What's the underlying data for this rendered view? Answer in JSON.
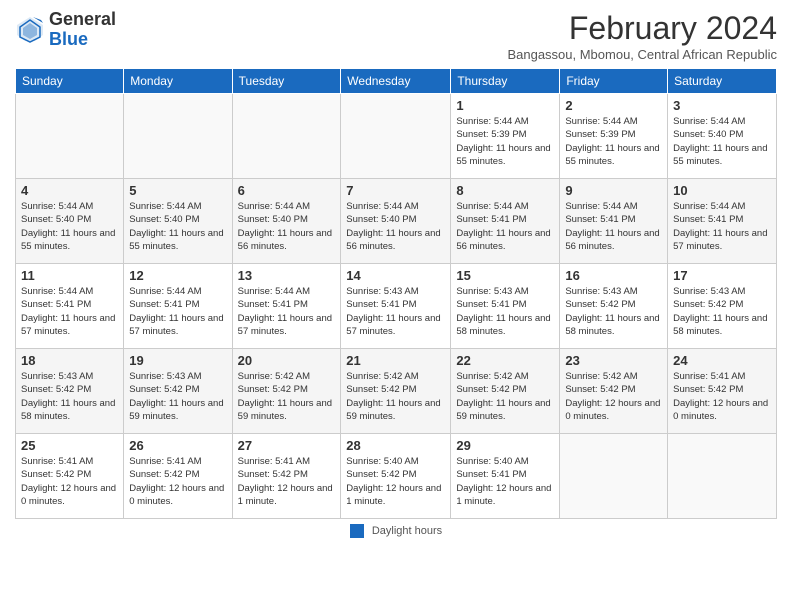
{
  "logo": {
    "general": "General",
    "blue": "Blue"
  },
  "title": "February 2024",
  "subtitle": "Bangassou, Mbomou, Central African Republic",
  "days_of_week": [
    "Sunday",
    "Monday",
    "Tuesday",
    "Wednesday",
    "Thursday",
    "Friday",
    "Saturday"
  ],
  "weeks": [
    [
      {
        "day": "",
        "info": ""
      },
      {
        "day": "",
        "info": ""
      },
      {
        "day": "",
        "info": ""
      },
      {
        "day": "",
        "info": ""
      },
      {
        "day": "1",
        "info": "Sunrise: 5:44 AM\nSunset: 5:39 PM\nDaylight: 11 hours and 55 minutes."
      },
      {
        "day": "2",
        "info": "Sunrise: 5:44 AM\nSunset: 5:39 PM\nDaylight: 11 hours and 55 minutes."
      },
      {
        "day": "3",
        "info": "Sunrise: 5:44 AM\nSunset: 5:40 PM\nDaylight: 11 hours and 55 minutes."
      }
    ],
    [
      {
        "day": "4",
        "info": "Sunrise: 5:44 AM\nSunset: 5:40 PM\nDaylight: 11 hours and 55 minutes."
      },
      {
        "day": "5",
        "info": "Sunrise: 5:44 AM\nSunset: 5:40 PM\nDaylight: 11 hours and 55 minutes."
      },
      {
        "day": "6",
        "info": "Sunrise: 5:44 AM\nSunset: 5:40 PM\nDaylight: 11 hours and 56 minutes."
      },
      {
        "day": "7",
        "info": "Sunrise: 5:44 AM\nSunset: 5:40 PM\nDaylight: 11 hours and 56 minutes."
      },
      {
        "day": "8",
        "info": "Sunrise: 5:44 AM\nSunset: 5:41 PM\nDaylight: 11 hours and 56 minutes."
      },
      {
        "day": "9",
        "info": "Sunrise: 5:44 AM\nSunset: 5:41 PM\nDaylight: 11 hours and 56 minutes."
      },
      {
        "day": "10",
        "info": "Sunrise: 5:44 AM\nSunset: 5:41 PM\nDaylight: 11 hours and 57 minutes."
      }
    ],
    [
      {
        "day": "11",
        "info": "Sunrise: 5:44 AM\nSunset: 5:41 PM\nDaylight: 11 hours and 57 minutes."
      },
      {
        "day": "12",
        "info": "Sunrise: 5:44 AM\nSunset: 5:41 PM\nDaylight: 11 hours and 57 minutes."
      },
      {
        "day": "13",
        "info": "Sunrise: 5:44 AM\nSunset: 5:41 PM\nDaylight: 11 hours and 57 minutes."
      },
      {
        "day": "14",
        "info": "Sunrise: 5:43 AM\nSunset: 5:41 PM\nDaylight: 11 hours and 57 minutes."
      },
      {
        "day": "15",
        "info": "Sunrise: 5:43 AM\nSunset: 5:41 PM\nDaylight: 11 hours and 58 minutes."
      },
      {
        "day": "16",
        "info": "Sunrise: 5:43 AM\nSunset: 5:42 PM\nDaylight: 11 hours and 58 minutes."
      },
      {
        "day": "17",
        "info": "Sunrise: 5:43 AM\nSunset: 5:42 PM\nDaylight: 11 hours and 58 minutes."
      }
    ],
    [
      {
        "day": "18",
        "info": "Sunrise: 5:43 AM\nSunset: 5:42 PM\nDaylight: 11 hours and 58 minutes."
      },
      {
        "day": "19",
        "info": "Sunrise: 5:43 AM\nSunset: 5:42 PM\nDaylight: 11 hours and 59 minutes."
      },
      {
        "day": "20",
        "info": "Sunrise: 5:42 AM\nSunset: 5:42 PM\nDaylight: 11 hours and 59 minutes."
      },
      {
        "day": "21",
        "info": "Sunrise: 5:42 AM\nSunset: 5:42 PM\nDaylight: 11 hours and 59 minutes."
      },
      {
        "day": "22",
        "info": "Sunrise: 5:42 AM\nSunset: 5:42 PM\nDaylight: 11 hours and 59 minutes."
      },
      {
        "day": "23",
        "info": "Sunrise: 5:42 AM\nSunset: 5:42 PM\nDaylight: 12 hours and 0 minutes."
      },
      {
        "day": "24",
        "info": "Sunrise: 5:41 AM\nSunset: 5:42 PM\nDaylight: 12 hours and 0 minutes."
      }
    ],
    [
      {
        "day": "25",
        "info": "Sunrise: 5:41 AM\nSunset: 5:42 PM\nDaylight: 12 hours and 0 minutes."
      },
      {
        "day": "26",
        "info": "Sunrise: 5:41 AM\nSunset: 5:42 PM\nDaylight: 12 hours and 0 minutes."
      },
      {
        "day": "27",
        "info": "Sunrise: 5:41 AM\nSunset: 5:42 PM\nDaylight: 12 hours and 1 minute."
      },
      {
        "day": "28",
        "info": "Sunrise: 5:40 AM\nSunset: 5:42 PM\nDaylight: 12 hours and 1 minute."
      },
      {
        "day": "29",
        "info": "Sunrise: 5:40 AM\nSunset: 5:41 PM\nDaylight: 12 hours and 1 minute."
      },
      {
        "day": "",
        "info": ""
      },
      {
        "day": "",
        "info": ""
      }
    ]
  ],
  "footer": {
    "legend_label": "Daylight hours"
  }
}
